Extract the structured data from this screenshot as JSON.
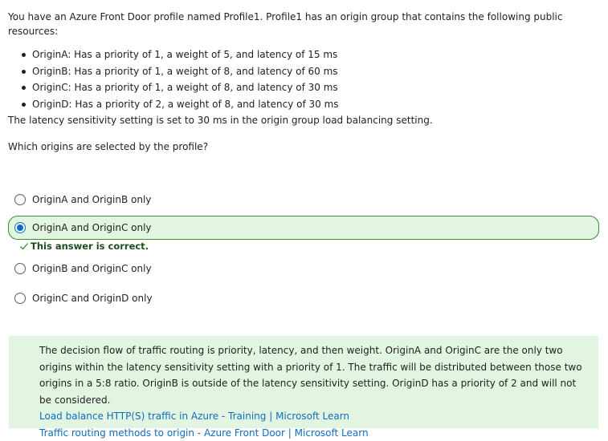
{
  "question": {
    "intro": "You have an Azure Front Door profile named Profile1. Profile1 has an origin group that contains the following public resources:",
    "items": [
      "OriginA: Has a priority of 1, a weight of 5, and latency of 15 ms",
      "OriginB: Has a priority of 1, a weight of 8, and latency of 60 ms",
      "OriginC: Has a priority of 1, a weight of 8, and latency of 30 ms",
      "OriginD: Has a priority of 2, a weight of 8, and latency of 30 ms"
    ],
    "note": "The latency sensitivity setting is set to 30 ms in the origin group load balancing setting.",
    "ask": "Which origins are selected by the profile?"
  },
  "options": [
    {
      "label": "OriginA and OriginB only",
      "selected": false
    },
    {
      "label": "OriginA and OriginC only",
      "selected": true
    },
    {
      "label": "OriginB and OriginC only",
      "selected": false
    },
    {
      "label": "OriginC and OriginD only",
      "selected": false
    }
  ],
  "feedback": {
    "text": "This answer is correct."
  },
  "explanation": {
    "text": "The decision flow of traffic routing is priority, latency, and then weight. OriginA and OriginC are the only two origins within the latency sensitivity setting with a priority of 1. The traffic will be distributed between those two origins in a 5:8 ratio. OriginB is outside of the latency sensitivity setting. OriginD has a priority of 2 and will not be considered.",
    "links": [
      "Load balance HTTP(S) traffic in Azure - Training | Microsoft Learn",
      "Traffic routing methods to origin - Azure Front Door | Microsoft Learn"
    ]
  },
  "colors": {
    "accent": "#0f6cbd",
    "success_bg": "#e2f5e1",
    "success_border": "#3b8a3b"
  }
}
